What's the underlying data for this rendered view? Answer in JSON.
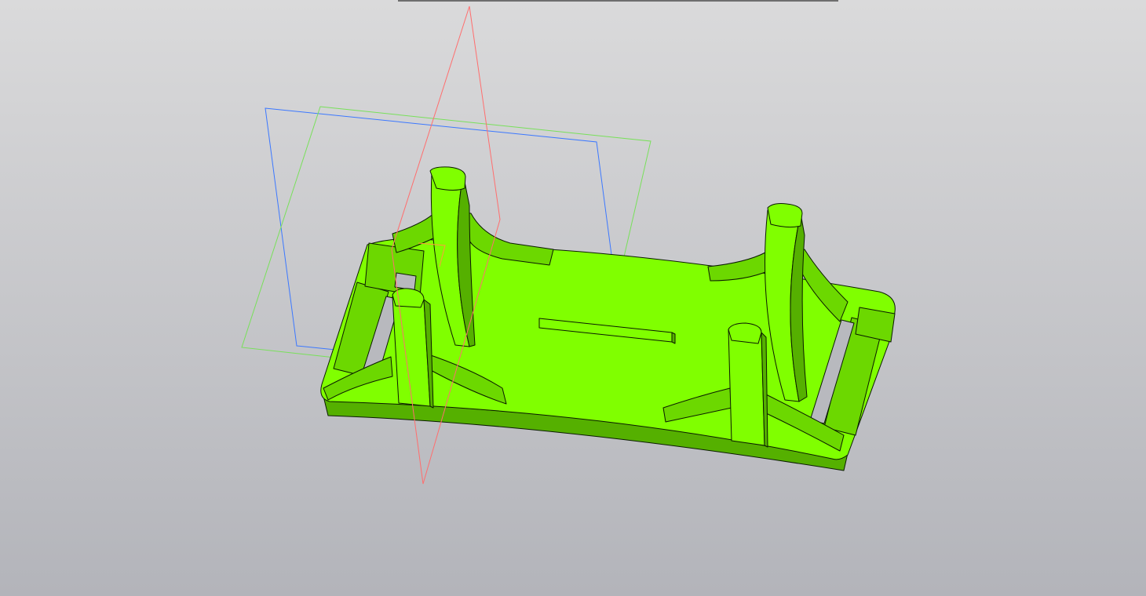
{
  "viewport": {
    "background_top": "#dadadb",
    "background_bottom": "#b3b4ba"
  },
  "colors": {
    "model_light": "#80ff00",
    "model_mid": "#6cd800",
    "model_dark": "#55b000",
    "model_shadow": "#3f8a00",
    "edge": "#0a1a00",
    "plane_front": "#3c78ff",
    "plane_side": "#78e05a",
    "plane_top": "#ff6e6e"
  },
  "icons": {
    "model": "3d-bracket-model",
    "plane_front": "front-plane",
    "plane_side": "side-plane",
    "plane_top": "top-plane",
    "origin": "origin-axes"
  }
}
